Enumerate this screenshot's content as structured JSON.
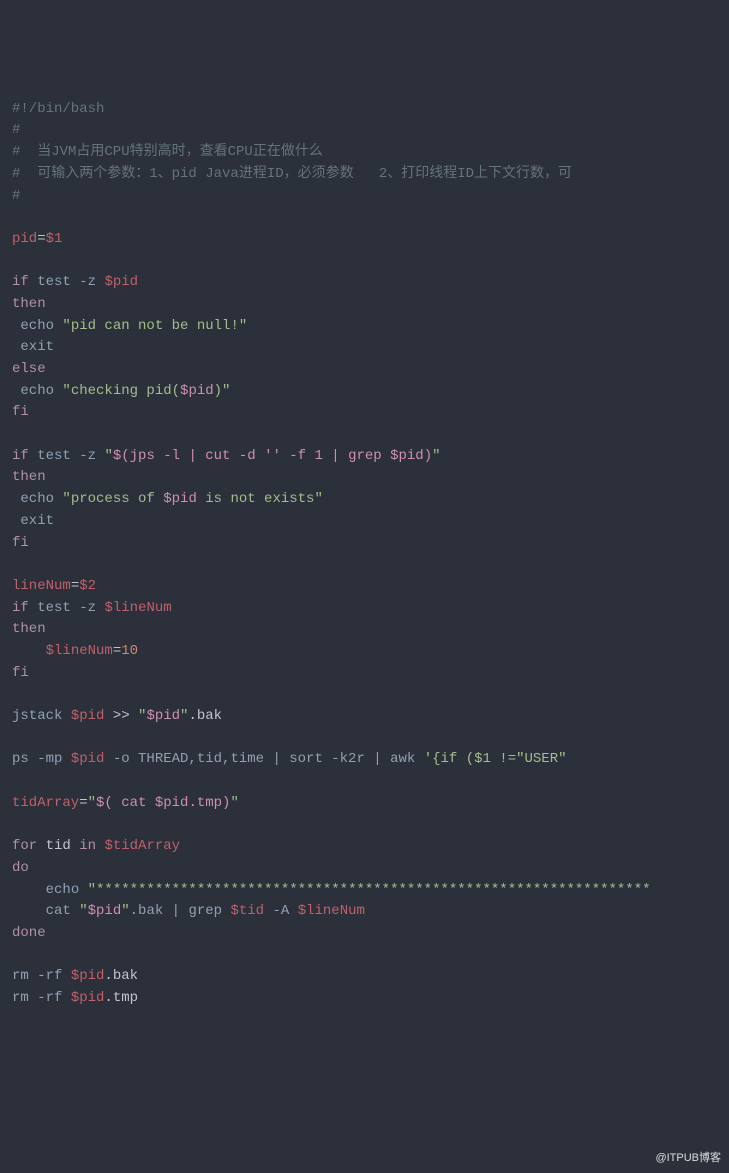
{
  "code": {
    "shebang": "#!/bin/bash",
    "c1": "#",
    "c2": "#  当JVM占用CPU特别高时，查看CPU正在做什么",
    "c3": "#  可输入两个参数：1、pid Java进程ID，必须参数   2、打印线程ID上下文行数，可",
    "c4": "#",
    "pid_assign_var": "pid",
    "pid_assign_eq": "=",
    "pid_assign_val": "$1",
    "if1": "if",
    "test1": " test -z ",
    "pidvar": "$pid",
    "then1": "then",
    "echo1": " echo",
    "str1": " \"pid can not be null!\"",
    "exit1": " exit",
    "else1": "else",
    "echo2": " echo",
    "str2a": " \"checking pid(",
    "str2b": "$pid",
    "str2c": ")\"",
    "fi1": "fi",
    "if2": "if",
    "test2a": " test -z ",
    "str3a": "\"",
    "str3b": "$(jps -l | cut -d '' -f 1 | grep $pid)",
    "str3c": "\"",
    "then2": "then",
    "echo3": " echo",
    "str4a": " \"process of ",
    "str4b": "$pid",
    "str4c": " is not exists\"",
    "exit2": " exit",
    "fi2": "fi",
    "ln_var": "lineNum",
    "ln_eq": "=",
    "ln_val": "$2",
    "if3": "if",
    "test3": " test -z ",
    "lnvar": "$lineNum",
    "then3": "then",
    "ln_assign_sp": "    ",
    "ln_assign_var": "$lineNum",
    "ln_assign_eq": "=",
    "ln_assign_num": "10",
    "fi3": "fi",
    "jstack_cmd": "jstack ",
    "jstack_pid": "$pid",
    "jstack_redir": " >> ",
    "jstack_file_a": "\"",
    "jstack_file_b": "$pid",
    "jstack_file_c": "\"",
    "jstack_bak": ".bak",
    "ps_a": "ps -mp ",
    "ps_pid": "$pid",
    "ps_b": " -o THREAD,tid,time | sort -k2r | awk ",
    "ps_awk_a": "'{if ($1 !=\"USER\"",
    "tidarr_var": "tidArray",
    "tidarr_eq": "=",
    "tidarr_str_a": "\"",
    "tidarr_str_b": "$( cat $pid.tmp)",
    "tidarr_str_c": "\"",
    "for1": "for",
    "for_tid": " tid ",
    "for_in": "in",
    "for_arr": " $tidArray",
    "do1": "do",
    "echo4_sp": "    ",
    "echo4": "echo",
    "echo4_str": " \"******************************************************************",
    "cat_sp": "    ",
    "cat_cmd": "cat ",
    "cat_file_a": "\"",
    "cat_file_b": "$pid",
    "cat_file_c": "\"",
    "cat_rest": ".bak | grep ",
    "cat_tid": "$tid",
    "cat_a": " -A ",
    "cat_ln": "$lineNum",
    "done1": "done",
    "rm1_a": "rm -rf ",
    "rm1_b": "$pid",
    "rm1_c": ".bak",
    "rm2_a": "rm -rf ",
    "rm2_b": "$pid",
    "rm2_c": ".tmp"
  },
  "watermark": "@ITPUB博客"
}
